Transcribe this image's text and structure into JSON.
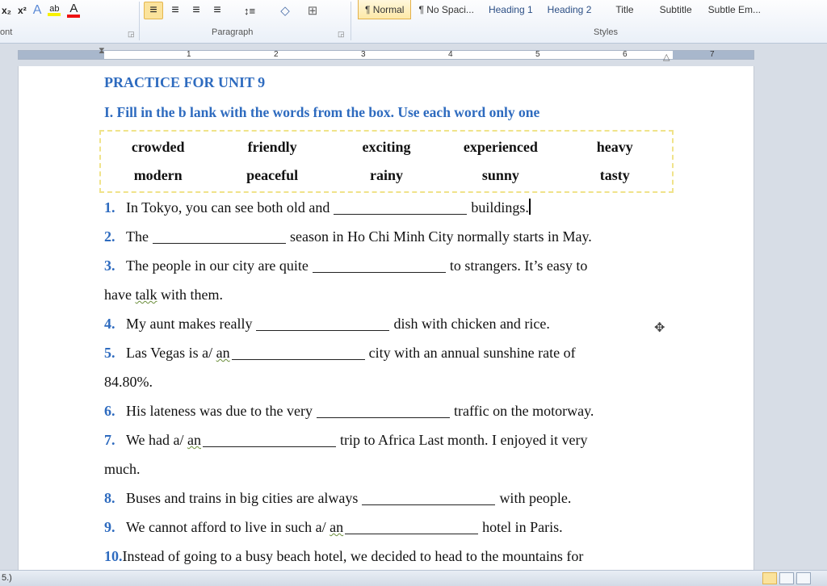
{
  "ribbon": {
    "font_group_label": "ont",
    "paragraph_group_label": "Paragraph",
    "styles_group_label": "Styles",
    "buttons": {
      "subscript": "x₂",
      "superscript": "x²",
      "text_effects": "A",
      "highlight": "ab",
      "font_color": "A",
      "align_left": "≡",
      "center": "≡",
      "align_right": "≡",
      "justify": "≡",
      "line_spacing": "↕≡",
      "shading": "◇",
      "borders": "⊞"
    },
    "styles": [
      "¶ Normal",
      "¶ No Spaci...",
      "Heading 1",
      "Heading 2",
      "Title",
      "Subtitle",
      "Subtle Em..."
    ],
    "selected_style": "¶ Normal"
  },
  "ruler": {
    "numbers": [
      "1",
      "2",
      "3",
      "4",
      "5",
      "6",
      "7"
    ]
  },
  "document": {
    "title": "PRACTICE FOR UNIT 9",
    "instruction": "I. Fill in the b lank with the words from the box. Use each word only one",
    "word_box": [
      "crowded",
      "friendly",
      "exciting",
      "experienced",
      "heavy",
      "modern",
      "peaceful",
      "rainy",
      "sunny",
      "tasty"
    ],
    "q1": {
      "num": "1.",
      "before": "In Tokyo, you can see both old and",
      "after": "buildings."
    },
    "q2": {
      "num": "2.",
      "before": "The",
      "after": "season in Ho Chi Minh City normally starts in May."
    },
    "q3": {
      "num": "3.",
      "before": "The people in our city are quite",
      "after": "to strangers. It’s easy to",
      "cont_a": "have ",
      "cont_squig": "talk",
      "cont_b": " with them."
    },
    "q4": {
      "num": "4.",
      "before": "My aunt makes really",
      "after": "dish with chicken and rice."
    },
    "q5": {
      "num": "5.",
      "before": "Las Vegas is a/ ",
      "squig": "an",
      "after": "city with an annual sunshine rate of",
      "cont": "84.80%."
    },
    "q6": {
      "num": "6.",
      "before": "His lateness was due to the very",
      "after": "traffic on the motorway."
    },
    "q7": {
      "num": "7.",
      "before": "We had a/ ",
      "squig": "an",
      "after": "trip to Africa Last month. I enjoyed it very",
      "cont": "much."
    },
    "q8": {
      "num": "8.",
      "before": "Buses and trains in big cities are always",
      "after": "with people."
    },
    "q9": {
      "num": "9.",
      "before": "We cannot afford to live in such a/ ",
      "squig": "an",
      "after": "hotel in Paris."
    },
    "q10": {
      "num": "10.",
      "text": "Instead of going to a busy beach hotel, we decided to head to the mountains for"
    }
  },
  "status": {
    "left_text": "5.)"
  },
  "colors": {
    "heading_blue": "#2e6bbf",
    "box_border": "#f0e38a"
  }
}
